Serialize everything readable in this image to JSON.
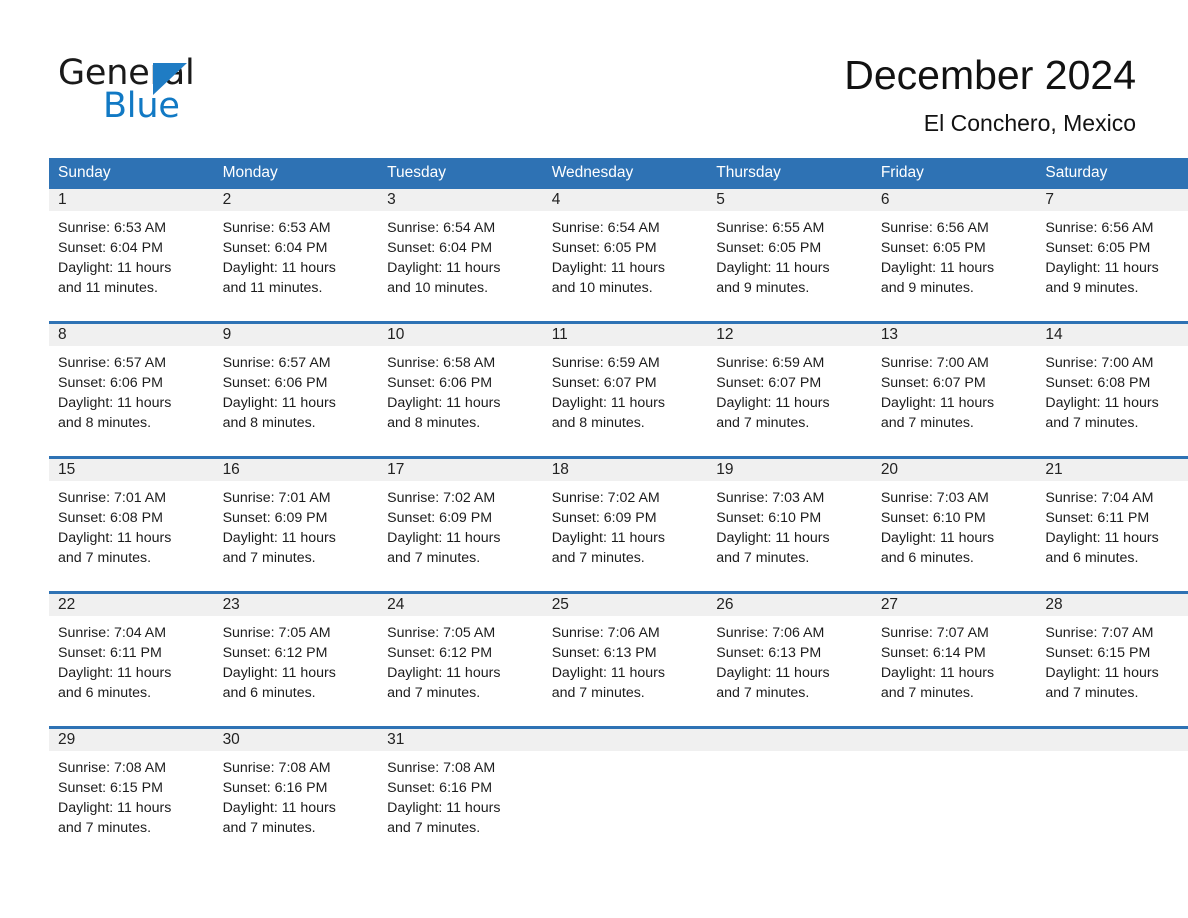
{
  "logo": {
    "word_top": "General",
    "word_bottom": "Blue",
    "triangle": "triangle-icon",
    "brand_color": "#1179c4"
  },
  "header": {
    "title": "December 2024",
    "subtitle": "El Conchero, Mexico"
  },
  "theme": {
    "header_blue": "#2e72b4",
    "daynum_bg": "#f0f0f0",
    "text": "#1c1c1c"
  },
  "weekdays": [
    "Sunday",
    "Monday",
    "Tuesday",
    "Wednesday",
    "Thursday",
    "Friday",
    "Saturday"
  ],
  "weeks": [
    [
      {
        "day": "1",
        "sunrise": "Sunrise: 6:53 AM",
        "sunset": "Sunset: 6:04 PM",
        "daylight1": "Daylight: 11 hours",
        "daylight2": "and 11 minutes."
      },
      {
        "day": "2",
        "sunrise": "Sunrise: 6:53 AM",
        "sunset": "Sunset: 6:04 PM",
        "daylight1": "Daylight: 11 hours",
        "daylight2": "and 11 minutes."
      },
      {
        "day": "3",
        "sunrise": "Sunrise: 6:54 AM",
        "sunset": "Sunset: 6:04 PM",
        "daylight1": "Daylight: 11 hours",
        "daylight2": "and 10 minutes."
      },
      {
        "day": "4",
        "sunrise": "Sunrise: 6:54 AM",
        "sunset": "Sunset: 6:05 PM",
        "daylight1": "Daylight: 11 hours",
        "daylight2": "and 10 minutes."
      },
      {
        "day": "5",
        "sunrise": "Sunrise: 6:55 AM",
        "sunset": "Sunset: 6:05 PM",
        "daylight1": "Daylight: 11 hours",
        "daylight2": "and 9 minutes."
      },
      {
        "day": "6",
        "sunrise": "Sunrise: 6:56 AM",
        "sunset": "Sunset: 6:05 PM",
        "daylight1": "Daylight: 11 hours",
        "daylight2": "and 9 minutes."
      },
      {
        "day": "7",
        "sunrise": "Sunrise: 6:56 AM",
        "sunset": "Sunset: 6:05 PM",
        "daylight1": "Daylight: 11 hours",
        "daylight2": "and 9 minutes."
      }
    ],
    [
      {
        "day": "8",
        "sunrise": "Sunrise: 6:57 AM",
        "sunset": "Sunset: 6:06 PM",
        "daylight1": "Daylight: 11 hours",
        "daylight2": "and 8 minutes."
      },
      {
        "day": "9",
        "sunrise": "Sunrise: 6:57 AM",
        "sunset": "Sunset: 6:06 PM",
        "daylight1": "Daylight: 11 hours",
        "daylight2": "and 8 minutes."
      },
      {
        "day": "10",
        "sunrise": "Sunrise: 6:58 AM",
        "sunset": "Sunset: 6:06 PM",
        "daylight1": "Daylight: 11 hours",
        "daylight2": "and 8 minutes."
      },
      {
        "day": "11",
        "sunrise": "Sunrise: 6:59 AM",
        "sunset": "Sunset: 6:07 PM",
        "daylight1": "Daylight: 11 hours",
        "daylight2": "and 8 minutes."
      },
      {
        "day": "12",
        "sunrise": "Sunrise: 6:59 AM",
        "sunset": "Sunset: 6:07 PM",
        "daylight1": "Daylight: 11 hours",
        "daylight2": "and 7 minutes."
      },
      {
        "day": "13",
        "sunrise": "Sunrise: 7:00 AM",
        "sunset": "Sunset: 6:07 PM",
        "daylight1": "Daylight: 11 hours",
        "daylight2": "and 7 minutes."
      },
      {
        "day": "14",
        "sunrise": "Sunrise: 7:00 AM",
        "sunset": "Sunset: 6:08 PM",
        "daylight1": "Daylight: 11 hours",
        "daylight2": "and 7 minutes."
      }
    ],
    [
      {
        "day": "15",
        "sunrise": "Sunrise: 7:01 AM",
        "sunset": "Sunset: 6:08 PM",
        "daylight1": "Daylight: 11 hours",
        "daylight2": "and 7 minutes."
      },
      {
        "day": "16",
        "sunrise": "Sunrise: 7:01 AM",
        "sunset": "Sunset: 6:09 PM",
        "daylight1": "Daylight: 11 hours",
        "daylight2": "and 7 minutes."
      },
      {
        "day": "17",
        "sunrise": "Sunrise: 7:02 AM",
        "sunset": "Sunset: 6:09 PM",
        "daylight1": "Daylight: 11 hours",
        "daylight2": "and 7 minutes."
      },
      {
        "day": "18",
        "sunrise": "Sunrise: 7:02 AM",
        "sunset": "Sunset: 6:09 PM",
        "daylight1": "Daylight: 11 hours",
        "daylight2": "and 7 minutes."
      },
      {
        "day": "19",
        "sunrise": "Sunrise: 7:03 AM",
        "sunset": "Sunset: 6:10 PM",
        "daylight1": "Daylight: 11 hours",
        "daylight2": "and 7 minutes."
      },
      {
        "day": "20",
        "sunrise": "Sunrise: 7:03 AM",
        "sunset": "Sunset: 6:10 PM",
        "daylight1": "Daylight: 11 hours",
        "daylight2": "and 6 minutes."
      },
      {
        "day": "21",
        "sunrise": "Sunrise: 7:04 AM",
        "sunset": "Sunset: 6:11 PM",
        "daylight1": "Daylight: 11 hours",
        "daylight2": "and 6 minutes."
      }
    ],
    [
      {
        "day": "22",
        "sunrise": "Sunrise: 7:04 AM",
        "sunset": "Sunset: 6:11 PM",
        "daylight1": "Daylight: 11 hours",
        "daylight2": "and 6 minutes."
      },
      {
        "day": "23",
        "sunrise": "Sunrise: 7:05 AM",
        "sunset": "Sunset: 6:12 PM",
        "daylight1": "Daylight: 11 hours",
        "daylight2": "and 6 minutes."
      },
      {
        "day": "24",
        "sunrise": "Sunrise: 7:05 AM",
        "sunset": "Sunset: 6:12 PM",
        "daylight1": "Daylight: 11 hours",
        "daylight2": "and 7 minutes."
      },
      {
        "day": "25",
        "sunrise": "Sunrise: 7:06 AM",
        "sunset": "Sunset: 6:13 PM",
        "daylight1": "Daylight: 11 hours",
        "daylight2": "and 7 minutes."
      },
      {
        "day": "26",
        "sunrise": "Sunrise: 7:06 AM",
        "sunset": "Sunset: 6:13 PM",
        "daylight1": "Daylight: 11 hours",
        "daylight2": "and 7 minutes."
      },
      {
        "day": "27",
        "sunrise": "Sunrise: 7:07 AM",
        "sunset": "Sunset: 6:14 PM",
        "daylight1": "Daylight: 11 hours",
        "daylight2": "and 7 minutes."
      },
      {
        "day": "28",
        "sunrise": "Sunrise: 7:07 AM",
        "sunset": "Sunset: 6:15 PM",
        "daylight1": "Daylight: 11 hours",
        "daylight2": "and 7 minutes."
      }
    ],
    [
      {
        "day": "29",
        "sunrise": "Sunrise: 7:08 AM",
        "sunset": "Sunset: 6:15 PM",
        "daylight1": "Daylight: 11 hours",
        "daylight2": "and 7 minutes."
      },
      {
        "day": "30",
        "sunrise": "Sunrise: 7:08 AM",
        "sunset": "Sunset: 6:16 PM",
        "daylight1": "Daylight: 11 hours",
        "daylight2": "and 7 minutes."
      },
      {
        "day": "31",
        "sunrise": "Sunrise: 7:08 AM",
        "sunset": "Sunset: 6:16 PM",
        "daylight1": "Daylight: 11 hours",
        "daylight2": "and 7 minutes."
      },
      {
        "day": "",
        "sunrise": "",
        "sunset": "",
        "daylight1": "",
        "daylight2": ""
      },
      {
        "day": "",
        "sunrise": "",
        "sunset": "",
        "daylight1": "",
        "daylight2": ""
      },
      {
        "day": "",
        "sunrise": "",
        "sunset": "",
        "daylight1": "",
        "daylight2": ""
      },
      {
        "day": "",
        "sunrise": "",
        "sunset": "",
        "daylight1": "",
        "daylight2": ""
      }
    ]
  ]
}
